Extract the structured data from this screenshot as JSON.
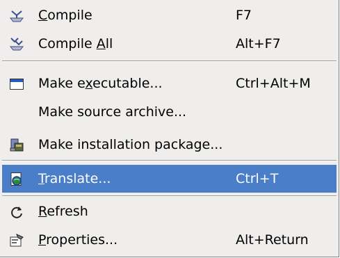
{
  "menu": {
    "items": [
      {
        "pre": "",
        "mnemonic": "C",
        "post": "ompile",
        "shortcut": "F7",
        "icon": "compile-icon"
      },
      {
        "pre": "Compile ",
        "mnemonic": "A",
        "post": "ll",
        "shortcut": "Alt+F7",
        "icon": "compile-all-icon"
      },
      {
        "pre": "Make e",
        "mnemonic": "x",
        "post": "ecutable...",
        "shortcut": "Ctrl+Alt+M",
        "icon": "window-icon"
      },
      {
        "pre": "Make source archive...",
        "mnemonic": "",
        "post": "",
        "shortcut": ""
      },
      {
        "pre": "Make installation package...",
        "mnemonic": "",
        "post": "",
        "shortcut": "",
        "icon": "installer-icon"
      },
      {
        "pre": "",
        "mnemonic": "T",
        "post": "ranslate...",
        "shortcut": "Ctrl+T",
        "icon": "translate-icon",
        "state": "highlighted"
      },
      {
        "pre": "",
        "mnemonic": "R",
        "post": "efresh",
        "shortcut": "",
        "icon": "refresh-icon"
      },
      {
        "pre": "",
        "mnemonic": "P",
        "post": "roperties...",
        "shortcut": "Alt+Return",
        "icon": "properties-icon"
      }
    ]
  },
  "colors": {
    "menu_background": "#efeeec",
    "highlight": "#4a7ec8",
    "highlight_text": "#ffffff"
  }
}
